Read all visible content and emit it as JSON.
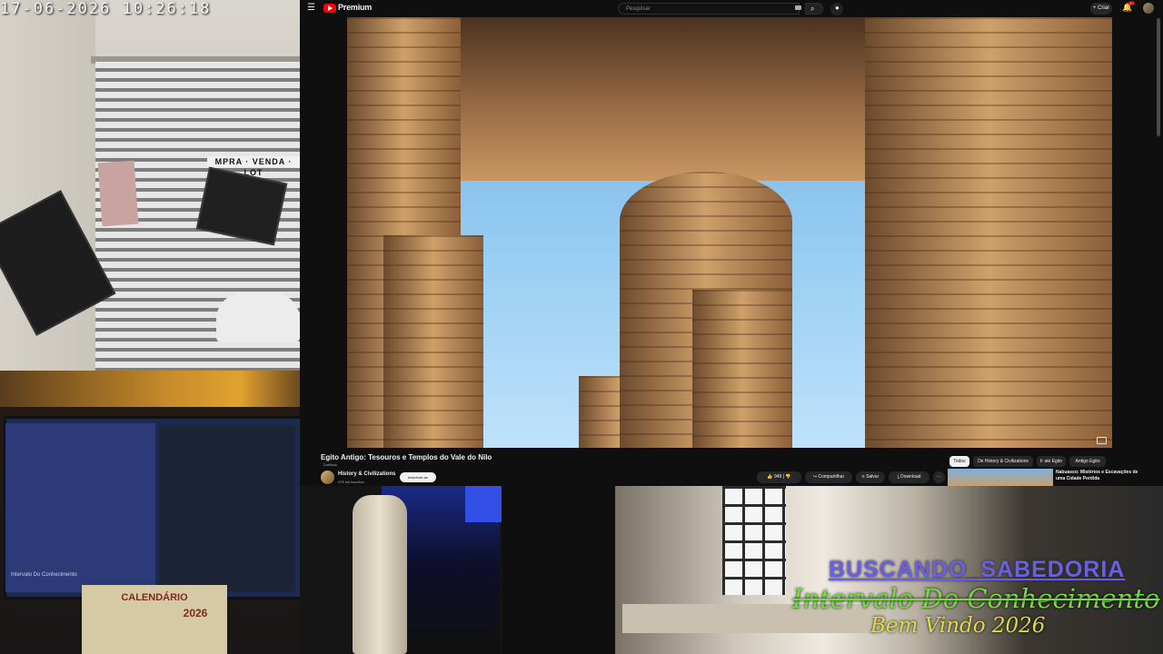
{
  "cctv": {
    "timestamp": "17-06-2026 10:26:18",
    "sign_text": "MPRA · VENDA · LOT"
  },
  "room": {
    "calendar_title": "CALENDÁRIO",
    "calendar_year": "2026",
    "monitor_text": "Intervalo Do Conhecimento"
  },
  "youtube": {
    "logo_text": "Premium",
    "search_placeholder": "Pesquisar",
    "create_label": "Criar",
    "notifications_badge": "9+",
    "video": {
      "title": "Egito Antigo: Tesouros e Templos do Vale do Nilo",
      "subtitle_tag": "Dublado"
    },
    "channel": {
      "name": "History & Civilizations",
      "subscribers": "475 mil inscritos",
      "subscribe_label": "Inscrever-se"
    },
    "actions": {
      "like_count": "949",
      "share_label": "Compartilhar",
      "save_label": "Salvar",
      "download_label": "Download"
    },
    "chips": [
      "Todos",
      "De History & Civilizations",
      "Ir até Egito",
      "Antigo Egito"
    ],
    "recommendation": {
      "title": "Nabuasso: Mistérios e Escavações de uma Cidade Perdida"
    }
  },
  "overlay": {
    "line1": "BUSCANDO_SABEDORIA",
    "line2": "Intervalo Do Conhecimento",
    "line3": "Bem Vindo 2026"
  },
  "colors": {
    "youtube_red": "#ff0000",
    "overlay_purple": "#6a5fe0",
    "overlay_green": "#7ad94a",
    "overlay_yellow": "#dcd94a"
  }
}
